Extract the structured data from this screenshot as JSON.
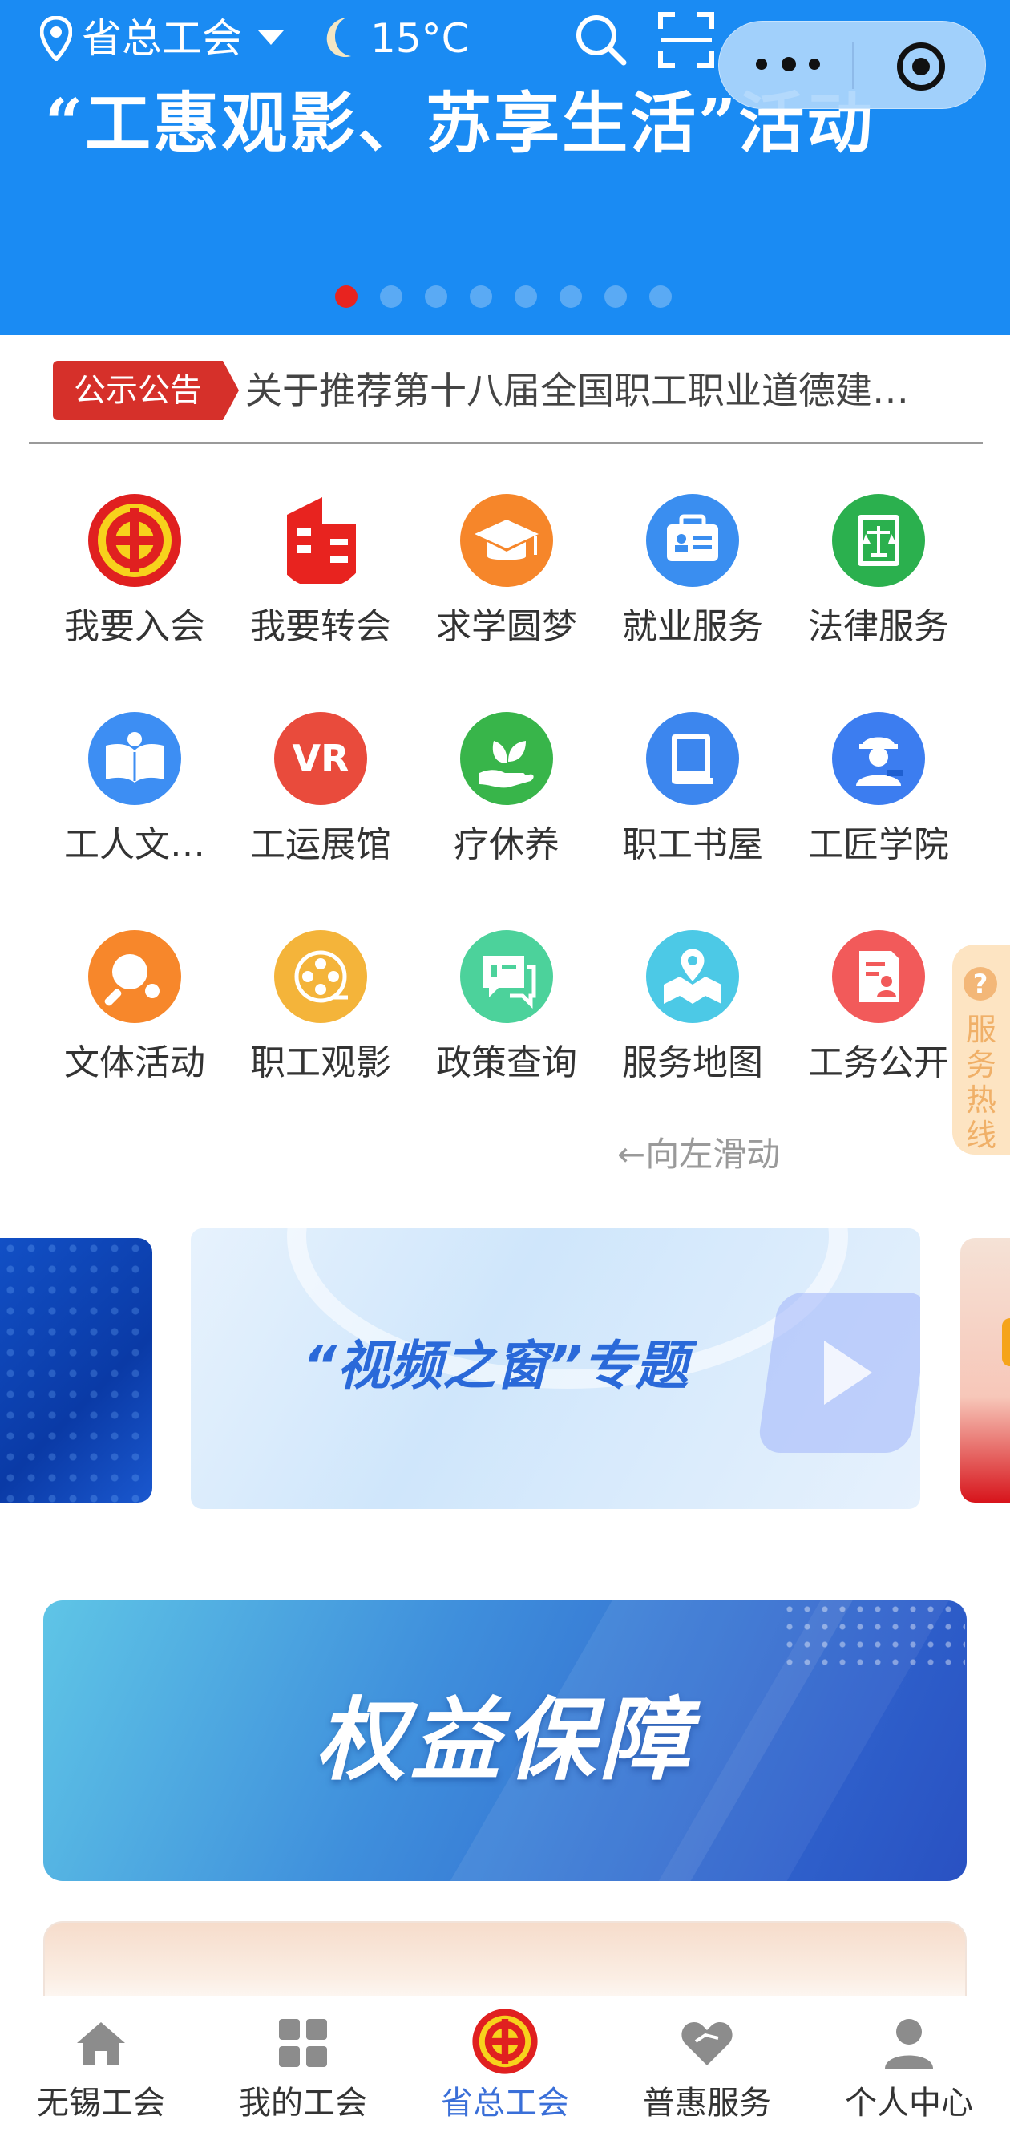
{
  "topbar": {
    "location": "省总工会",
    "temperature": "15°C",
    "location_icon": "location-pin-icon",
    "weather_icon": "moon-icon",
    "search_icon": "search-icon",
    "scan_icon": "scan-icon",
    "capsule_more_icon": "more-dots-icon",
    "capsule_close_icon": "target-close-icon"
  },
  "hero": {
    "title": "“工惠观影、苏享生活”活动",
    "background_color": "#1a8bf3",
    "slide_count": 8,
    "active_slide": 1,
    "active_dot_color": "#e8231f"
  },
  "notice": {
    "badge": "公示公告",
    "text": "关于推荐第十八届全国职工职业道德建…",
    "badge_color": "#d6302a"
  },
  "services": [
    {
      "label": "我要入会",
      "icon": "union-emblem-icon",
      "color": "#e02020"
    },
    {
      "label": "我要转会",
      "icon": "building-icon",
      "color": "#e8231f"
    },
    {
      "label": "求学圆梦",
      "icon": "graduation-cap-icon",
      "color": "#f6862a"
    },
    {
      "label": "就业服务",
      "icon": "briefcase-icon",
      "color": "#3a8ef0"
    },
    {
      "label": "法律服务",
      "icon": "law-book-icon",
      "color": "#2bb04e"
    },
    {
      "label": "工人文…",
      "icon": "open-book-icon",
      "color": "#3d8ef3"
    },
    {
      "label": "工运展馆",
      "icon": "vr-icon",
      "color": "#e94b3c"
    },
    {
      "label": "疗休养",
      "icon": "leaf-hand-icon",
      "color": "#38b54a"
    },
    {
      "label": "职工书屋",
      "icon": "book-icon",
      "color": "#3c86ee"
    },
    {
      "label": "工匠学院",
      "icon": "craftsman-icon",
      "color": "#3c7df0"
    },
    {
      "label": "文体活动",
      "icon": "ping-pong-icon",
      "color": "#f7872b"
    },
    {
      "label": "职工观影",
      "icon": "film-reel-icon",
      "color": "#f4b43a"
    },
    {
      "label": "政策查询",
      "icon": "chat-policy-icon",
      "color": "#4cd29b"
    },
    {
      "label": "服务地图",
      "icon": "map-pin-icon",
      "color": "#4cc9e6"
    },
    {
      "label": "工务公开",
      "icon": "document-person-icon",
      "color": "#f25a5a"
    }
  ],
  "swipe_hint": "←向左滑动",
  "hotline": {
    "label": "服务热线",
    "icon": "question-icon"
  },
  "carousel": {
    "main_caption": "“视频之窗”专题"
  },
  "rights_banner": {
    "caption": "权益保障"
  },
  "tabbar": {
    "items": [
      {
        "label": "无锡工会",
        "icon": "home-icon",
        "active": false
      },
      {
        "label": "我的工会",
        "icon": "grid-icon",
        "active": false
      },
      {
        "label": "省总工会",
        "icon": "union-emblem-icon",
        "active": true
      },
      {
        "label": "普惠服务",
        "icon": "heart-hands-icon",
        "active": false
      },
      {
        "label": "个人中心",
        "icon": "user-icon",
        "active": false
      }
    ],
    "active_color": "#3a6fd8"
  }
}
